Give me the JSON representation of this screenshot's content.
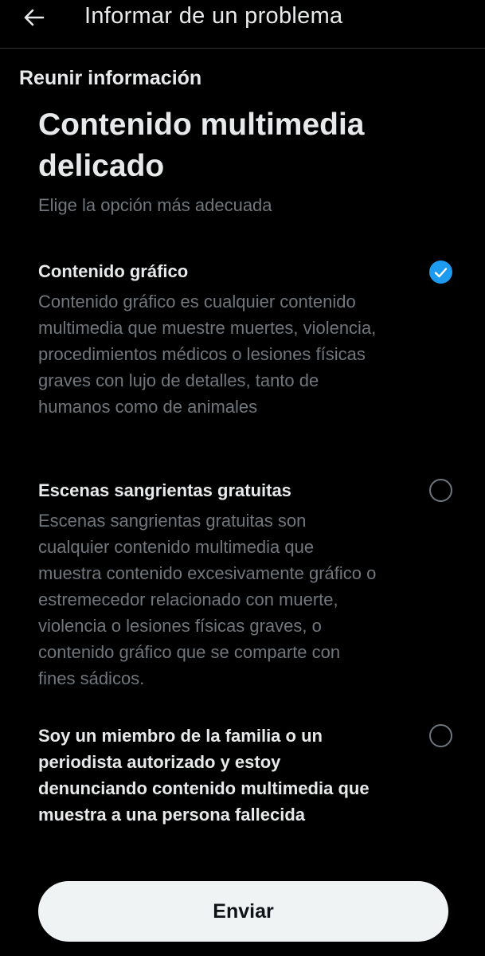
{
  "header": {
    "title": "Informar de un problema",
    "back_icon": "arrow-left-icon"
  },
  "section_label": "Reunir información",
  "main_title": "Contenido multimedia delicado",
  "subtitle": "Elige la opción más adecuada",
  "options": [
    {
      "label": "Contenido gráfico",
      "description": "Contenido gráfico es cualquier contenido multimedia que muestre muertes, violencia, procedimientos médicos o lesiones físicas graves con lujo de detalles, tanto de humanos como de animales",
      "selected": true
    },
    {
      "label": "Escenas sangrientas gratuitas",
      "description": "Escenas sangrientas gratuitas son cualquier contenido multimedia que muestra contenido excesivamente gráfico o estremecedor relacionado con muerte, violencia o lesiones físicas graves, o contenido gráfico que se comparte con fines sádicos.",
      "selected": false
    },
    {
      "label": "Soy un miembro de la familia o un periodista autorizado y estoy denunciando contenido multimedia que muestra a una persona fallecida",
      "description": "",
      "selected": false
    }
  ],
  "submit_label": "Enviar",
  "colors": {
    "background": "#000000",
    "accent": "#1d9bf0",
    "primary_text": "#e7e9ea",
    "secondary_text": "#71767b",
    "button_bg": "#eff3f4"
  }
}
